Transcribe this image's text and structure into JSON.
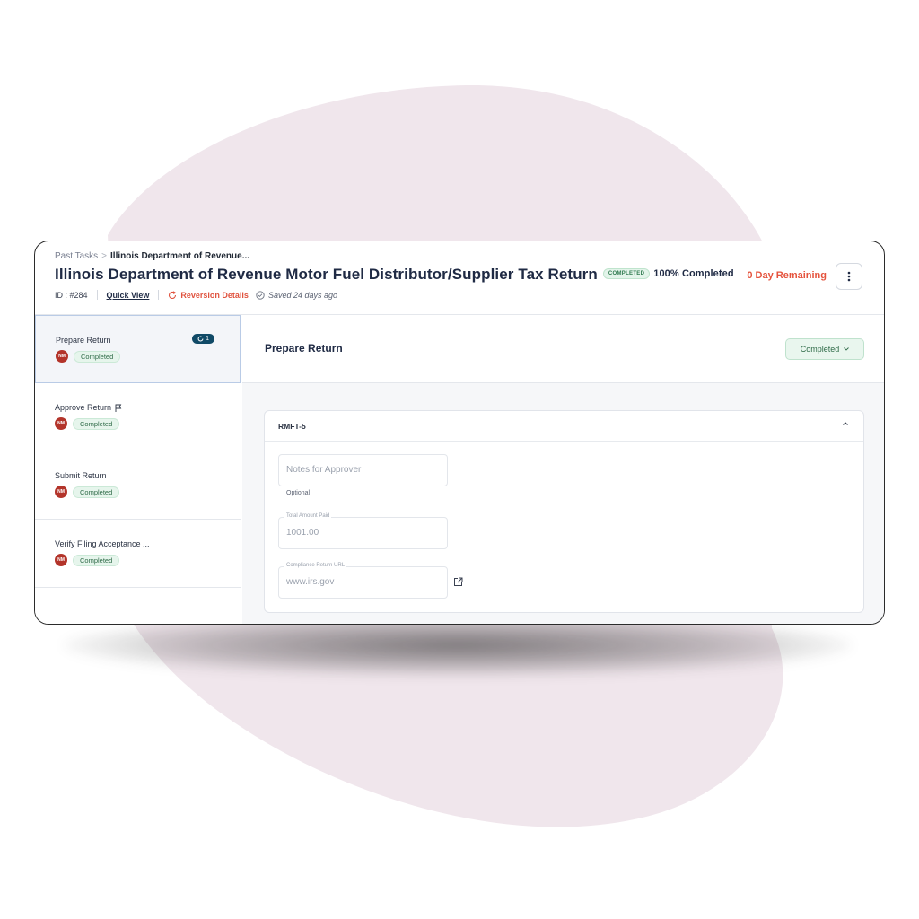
{
  "breadcrumb": {
    "parent": "Past Tasks",
    "current": "Illinois Department of Revenue..."
  },
  "task": {
    "title": "Illinois Department of Revenue Motor Fuel Distributor/Supplier Tax Return",
    "status_chip": "COMPLETED",
    "percent_label": "100% Completed",
    "remaining": "0 Day Remaining"
  },
  "meta": {
    "id": "ID : #284",
    "quick_view": "Quick View",
    "reversion": "Reversion Details",
    "saved": "Saved 24 days ago"
  },
  "steps": [
    {
      "label": "Prepare Return",
      "avatar": "NM",
      "status": "Completed",
      "revision_count": "1"
    },
    {
      "label": "Approve Return",
      "avatar": "NM",
      "status": "Completed"
    },
    {
      "label": "Submit Return",
      "avatar": "NM",
      "status": "Completed"
    },
    {
      "label": "Verify Filing Acceptance ...",
      "avatar": "NM",
      "status": "Completed"
    }
  ],
  "main": {
    "title": "Prepare Return",
    "status_button": "Completed",
    "section": "RMFT-5",
    "fields": {
      "notes_placeholder": "Notes for Approver",
      "notes_hint": "Optional",
      "total_label": "Total Amount Paid",
      "total_value": "1001.00",
      "url_label": "Compliance Return URL",
      "url_value": "www.irs.gov"
    }
  },
  "icons": {
    "kebab": "more-vertical-icon",
    "flag": "flag-icon",
    "saved": "check-circle-icon",
    "reversion": "refresh-icon",
    "external": "external-link-icon"
  },
  "colors": {
    "brand_navy": "#1f2a44",
    "accent_red": "#e5533d",
    "success_green": "#2f6b48",
    "avatar_red": "#b3342a",
    "badge_blue": "#104a67",
    "blob": "#f0e6ec"
  }
}
